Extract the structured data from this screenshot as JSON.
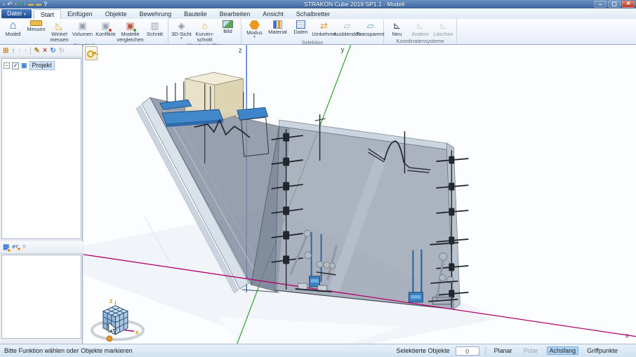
{
  "window": {
    "title": "STRAKON Cube 2019 SP1.1 - Modell",
    "controls": [
      {
        "name": "minimize",
        "icon": "minimize-icon"
      },
      {
        "name": "maximize",
        "icon": "maximize-icon"
      },
      {
        "name": "close",
        "icon": "close-icon"
      }
    ]
  },
  "qat": {
    "items": [
      {
        "icon": "save-icon"
      },
      {
        "icon": "undo-icon"
      },
      {
        "icon": "modules-icon"
      },
      {
        "icon": "check-icon"
      },
      {
        "icon": "layers-icon"
      },
      {
        "icon": "folder-icon"
      },
      {
        "icon": "folder-open-icon"
      },
      {
        "icon": "help-icon"
      }
    ]
  },
  "tabs": {
    "items": [
      "Datei",
      "Start",
      "Einfügen",
      "Objekte",
      "Bewehrung",
      "Bauteile",
      "Bearbeiten",
      "Ansicht",
      "Schalbretter"
    ],
    "active": "Start"
  },
  "ribbon": {
    "groups": [
      {
        "label": "Standard",
        "buttons": [
          {
            "label": "Modell",
            "icon": "model-icon"
          },
          {
            "label": "Messen",
            "icon": "ruler-icon"
          },
          {
            "label": "Winkel messen",
            "icon": "protractor-icon"
          },
          {
            "label": "Volumen",
            "icon": "volume-icon"
          },
          {
            "label": "Konflikte",
            "icon": "conflict-icon"
          },
          {
            "label": "Modelle vergleichen",
            "icon": "compare-icon"
          },
          {
            "label": "Schnitt",
            "icon": "section-icon"
          }
        ]
      },
      {
        "label": "Abgabe in Plan",
        "buttons": [
          {
            "label": "3D-Sicht",
            "icon": "view3d-icon",
            "dropdown": true
          },
          {
            "label": "Kurven-schnitt",
            "icon": "curve-icon"
          },
          {
            "label": "Bild",
            "icon": "image-icon"
          }
        ]
      },
      {
        "label": "Selektion",
        "buttons": [
          {
            "label": "Modus",
            "icon": "mode-icon",
            "dropdown": true
          },
          {
            "label": "Material",
            "icon": "material-icon"
          },
          {
            "label": "Daten",
            "icon": "data-list-icon"
          },
          {
            "label": "Umkehren",
            "icon": "invert-icon"
          },
          {
            "label": "Ausblenden",
            "icon": "hide-icon"
          },
          {
            "label": "Transparent",
            "icon": "transparent-icon"
          }
        ]
      },
      {
        "label": "Koordinatensysteme",
        "buttons": [
          {
            "label": "Neu",
            "icon": "axes-icon"
          },
          {
            "label": "Ändern",
            "icon": "axes-disabled-icon",
            "disabled": true
          },
          {
            "label": "Löschen",
            "icon": "axes-disabled-icon",
            "disabled": true
          }
        ]
      }
    ]
  },
  "left_panel": {
    "tree_toolbar": [
      "structure-icon",
      "arrow-up-active-icon",
      "arrow-up-icon",
      "arrow-up-icon",
      "pencil-icon",
      "delete-x-icon",
      "refresh-icon",
      "gear-icon"
    ],
    "tree_item": "Projekt",
    "bottom_toolbar": [
      "new-entry-icon",
      "ifc-icon",
      "remove-icon"
    ]
  },
  "viewport": {
    "axis_labels": {
      "x": "x",
      "y": "y",
      "z": "z"
    },
    "cube_labels": {
      "z": "z",
      "x": "x"
    },
    "tool_button_icon": "key-icon"
  },
  "status": {
    "message": "Bitte Funktion wählen oder Objekte markieren",
    "selected_label": "Selektierte Objekte",
    "selected_value": "0",
    "toggles": [
      {
        "label": "Planar",
        "state": "normal"
      },
      {
        "label": "Polar",
        "state": "disabled"
      },
      {
        "label": "Achsfang",
        "state": "active"
      },
      {
        "label": "Griffpunkte",
        "state": "normal"
      }
    ]
  },
  "colors": {
    "accent": "#2f66b0",
    "axis_x": "#b5006e",
    "axis_y": "#2ea22e",
    "axis_z": "#3a6fc4",
    "platform_blue": "#4289cc",
    "concrete_beige": "#ece4cb",
    "status_highlight": "#add2f2"
  }
}
